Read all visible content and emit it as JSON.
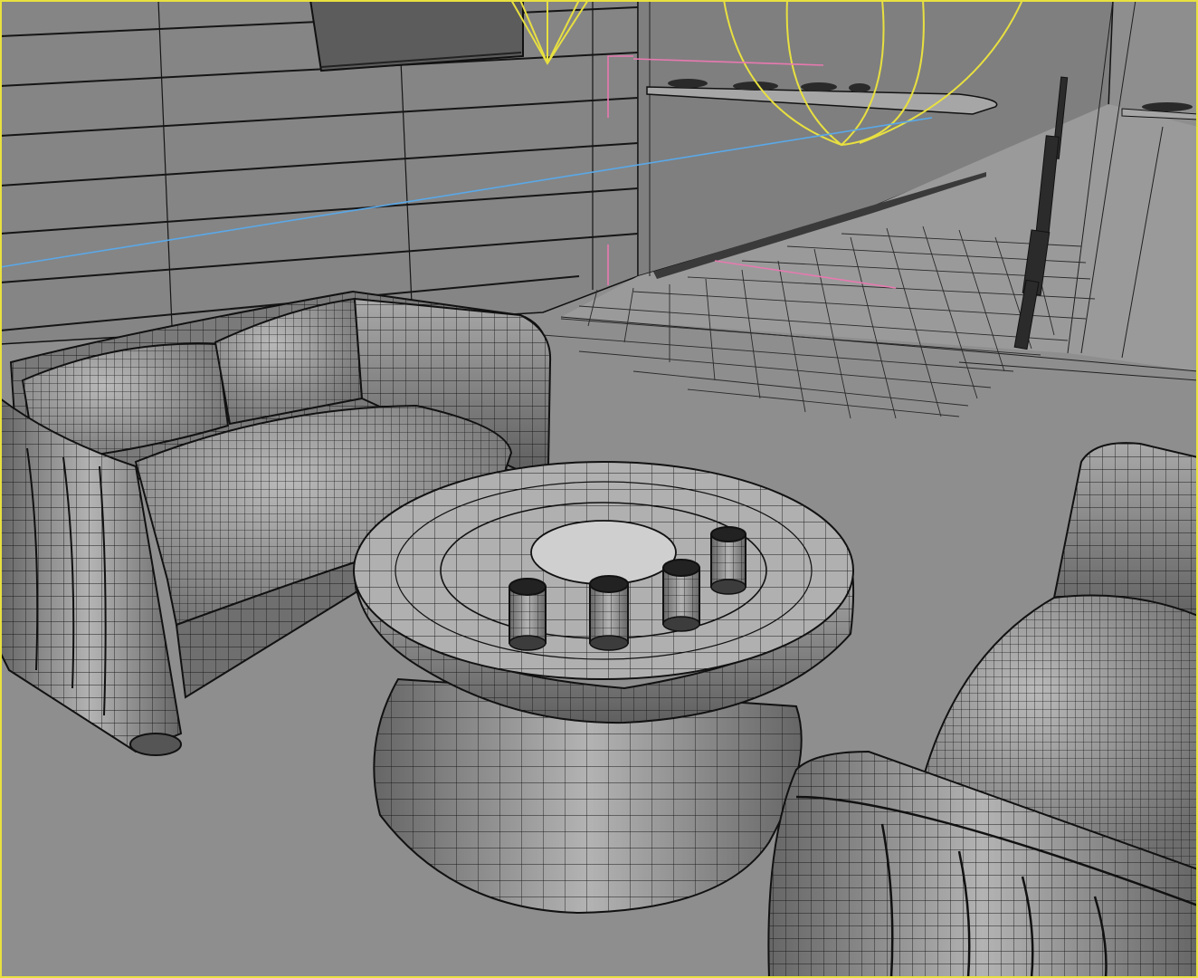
{
  "viewport": {
    "mode": "wireframe-on-shaded",
    "active": true,
    "colors": {
      "background": "#8d8d8d",
      "floor": "#8e8e8e",
      "wall": "#858585",
      "wireframe": "#111111",
      "light_gizmo": "#e8e040",
      "camera_gizmo": "#e879b0",
      "target_line": "#5aa8e8",
      "active_border": "#e8e040"
    }
  },
  "scene": {
    "objects": [
      {
        "id": "sofa",
        "icon": "sofa-icon"
      },
      {
        "id": "armchair",
        "icon": "armchair-icon"
      },
      {
        "id": "coffee-table",
        "icon": "table-icon"
      },
      {
        "id": "cups",
        "count": 4,
        "icon": "cup-icon"
      },
      {
        "id": "wall-tv",
        "icon": "tv-icon"
      },
      {
        "id": "wall-shelf",
        "icon": "shelf-icon"
      },
      {
        "id": "rifle",
        "icon": "rifle-icon"
      },
      {
        "id": "spotlight",
        "icon": "spotlight-icon"
      },
      {
        "id": "omni-light",
        "icon": "light-icon"
      },
      {
        "id": "camera",
        "icon": "camera-icon"
      }
    ]
  }
}
